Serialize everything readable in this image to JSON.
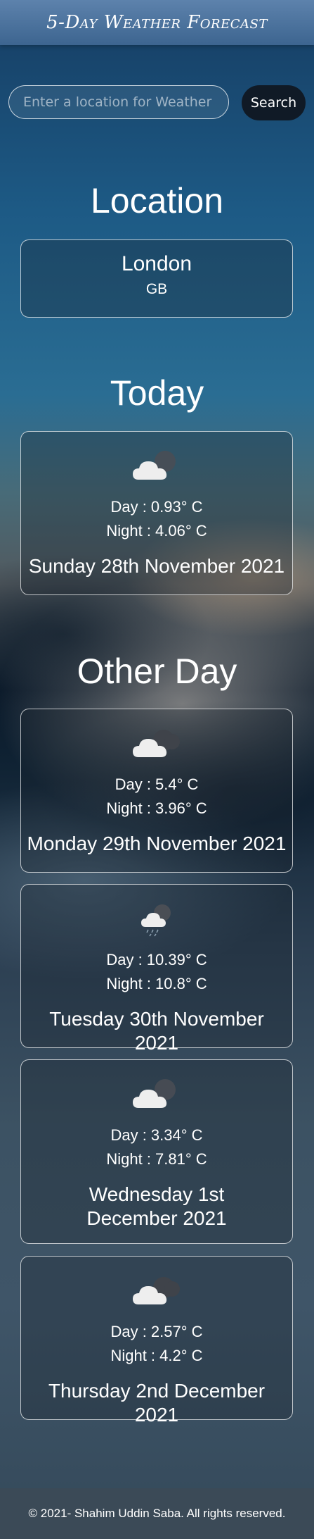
{
  "header": {
    "title": "5-Day Weather Forecast"
  },
  "search": {
    "placeholder": "Enter a location for Weather Forecast",
    "value": "",
    "button_label": "Search"
  },
  "location": {
    "heading": "Location",
    "city": "London",
    "country": "GB"
  },
  "today": {
    "heading": "Today",
    "icon": "cloudy-icon",
    "day_temp": "Day : 0.93° C",
    "night_temp": "Night : 4.06° C",
    "date": "Sunday 28th November 2021"
  },
  "other_days": {
    "heading": "Other Day",
    "items": [
      {
        "icon": "cloudy-icon",
        "day_temp": "Day : 5.4° C",
        "night_temp": "Night : 3.96° C",
        "date": "Monday 29th November 2021"
      },
      {
        "icon": "rain-cloud-icon",
        "day_temp": "Day : 10.39° C",
        "night_temp": "Night : 10.8° C",
        "date": "Tuesday 30th November 2021"
      },
      {
        "icon": "cloudy-icon",
        "day_temp": "Day : 3.34° C",
        "night_temp": "Night : 7.81° C",
        "date": "Wednesday 1st December 2021"
      },
      {
        "icon": "cloudy-icon",
        "day_temp": "Day : 2.57° C",
        "night_temp": "Night : 4.2° C",
        "date": "Thursday 2nd December 2021"
      }
    ]
  },
  "footer": {
    "copyright": "© 2021- Shahim Uddin Saba. All rights reserved."
  },
  "colors": {
    "header": "#4d74a0",
    "footer": "#3b4a57",
    "button": "#101a26",
    "text": "#ffffff"
  }
}
